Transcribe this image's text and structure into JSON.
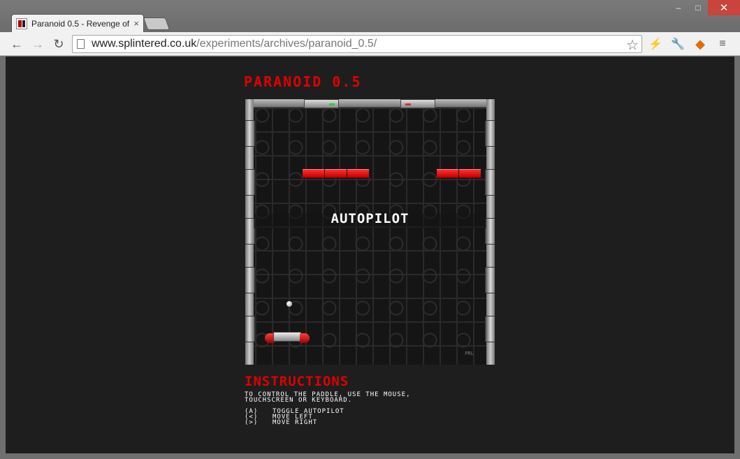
{
  "browser": {
    "tab_title": "Paranoid 0.5 - Revenge of",
    "tab_close": "×",
    "window_controls": {
      "minimize": "‒",
      "maximize": "□",
      "close": "✕"
    },
    "nav": {
      "back": "←",
      "forward": "→",
      "reload": "↻"
    },
    "url_host": "www.splintered.co.uk",
    "url_path": "/experiments/archives/paranoid_0.5/",
    "bookmark_star": "☆",
    "extensions": {
      "flash": "⚡",
      "wrench": "🔧",
      "avast": "◆",
      "menu": "≡"
    }
  },
  "page": {
    "title": "PARANOID 0.5",
    "overlay": "AUTOPILOT",
    "signature": "PRL",
    "instructions_title": "INSTRUCTIONS",
    "instructions_line1": "TO CONTROL THE PADDLE, USE THE MOUSE,",
    "instructions_line2": "TOUCHSCREEN OR KEYBOARD.",
    "keys": [
      {
        "key": "(A)",
        "action": "TOGGLE AUTOPILOT"
      },
      {
        "key": "(<)",
        "action": "MOVE LEFT"
      },
      {
        "key": "(>)",
        "action": "MOVE RIGHT"
      }
    ]
  },
  "colors": {
    "accent_red": "#e00000",
    "background": "#1e1e1e",
    "brick": "#ff2020"
  }
}
